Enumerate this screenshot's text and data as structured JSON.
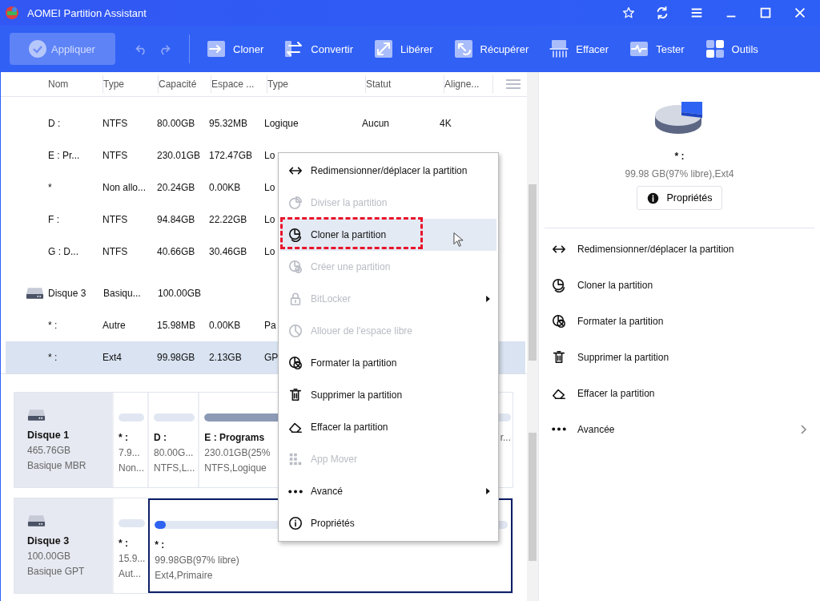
{
  "window": {
    "title": "AOMEI Partition Assistant"
  },
  "toolbar": {
    "apply": {
      "label": "Appliquer",
      "disabled": true
    },
    "tools": [
      {
        "kind": "clone",
        "label": "Cloner"
      },
      {
        "kind": "convert",
        "label": "Convertir"
      },
      {
        "kind": "free",
        "label": "Libérer"
      },
      {
        "kind": "recover",
        "label": "Récupérer"
      },
      {
        "kind": "wipe",
        "label": "Effacer"
      },
      {
        "kind": "test",
        "label": "Tester"
      },
      {
        "kind": "tools",
        "label": "Outils"
      }
    ]
  },
  "table": {
    "columns": [
      "Nom",
      "Type",
      "Capacité",
      "Espace ...",
      "Type",
      "Statut",
      "Aligne..."
    ],
    "rows": [
      {
        "kind": "partition",
        "selected": false,
        "cells": [
          "D :",
          "NTFS",
          "80.00GB",
          "95.32MB",
          "Logique",
          "Aucun",
          "4K"
        ]
      },
      {
        "kind": "partition",
        "selected": false,
        "cells": [
          "E : Pr...",
          "NTFS",
          "230.01GB",
          "172.47GB",
          "Lo"
        ]
      },
      {
        "kind": "partition",
        "selected": false,
        "cells": [
          "*",
          "Non allo...",
          "20.24GB",
          "0.00KB",
          "Lo"
        ]
      },
      {
        "kind": "partition",
        "selected": false,
        "cells": [
          "F :",
          "NTFS",
          "94.84GB",
          "22.22GB",
          "Lo"
        ]
      },
      {
        "kind": "partition",
        "selected": false,
        "cells": [
          "G : D...",
          "NTFS",
          "40.66GB",
          "30.46GB",
          "Lo"
        ]
      },
      {
        "kind": "disk",
        "selected": false,
        "cells": [
          "Disque 3",
          "Basiqu...",
          "100.00GB"
        ]
      },
      {
        "kind": "partition",
        "selected": false,
        "cells": [
          "* :",
          "Autre",
          "15.98MB",
          "0.00KB",
          "Pa"
        ]
      },
      {
        "kind": "partition",
        "selected": true,
        "cells": [
          "* :",
          "Ext4",
          "99.98GB",
          "2.13GB",
          "GP"
        ]
      }
    ]
  },
  "context_menu": {
    "items": [
      {
        "kind": "resize",
        "label": "Redimensionner/déplacer la partition",
        "disabled": false,
        "selected": false,
        "submenu": false,
        "annotated": false
      },
      {
        "kind": "split",
        "label": "Diviser la partition",
        "disabled": true,
        "selected": false,
        "submenu": false,
        "annotated": false
      },
      {
        "kind": "clone",
        "label": "Cloner la partition",
        "disabled": false,
        "selected": true,
        "submenu": false,
        "annotated": true
      },
      {
        "kind": "create",
        "label": "Créer une partition",
        "disabled": true,
        "selected": false,
        "submenu": false,
        "annotated": false
      },
      {
        "kind": "lock",
        "label": "BitLocker",
        "disabled": true,
        "selected": false,
        "submenu": true,
        "annotated": false
      },
      {
        "kind": "allocate",
        "label": "Allouer de l'espace libre",
        "disabled": true,
        "selected": false,
        "submenu": false,
        "annotated": false
      },
      {
        "kind": "format",
        "label": "Formater la partition",
        "disabled": false,
        "selected": false,
        "submenu": false,
        "annotated": false
      },
      {
        "kind": "delete",
        "label": "Supprimer la partition",
        "disabled": false,
        "selected": false,
        "submenu": false,
        "annotated": false
      },
      {
        "kind": "wipe",
        "label": "Effacer la partition",
        "disabled": false,
        "selected": false,
        "submenu": false,
        "annotated": false
      },
      {
        "kind": "apps",
        "label": "App Mover",
        "disabled": true,
        "selected": false,
        "submenu": false,
        "annotated": false
      },
      {
        "kind": "more",
        "label": "Avancé",
        "disabled": false,
        "selected": false,
        "submenu": true,
        "annotated": false
      },
      {
        "kind": "info",
        "label": "Propriétés",
        "disabled": false,
        "selected": false,
        "submenu": false,
        "annotated": false
      }
    ]
  },
  "disk_map": {
    "disks": [
      {
        "name": "Disque 1",
        "size": "465.76GB",
        "type": "Basique MBR",
        "partitions": [
          {
            "name": "* :",
            "size": "7.9...",
            "info": "Non...",
            "level": 0,
            "selected": false
          },
          {
            "name": "D :",
            "size": "80.00G...",
            "info": "NTFS,L...",
            "level": 0,
            "selected": false
          },
          {
            "name": "E : Programs",
            "size": "230.01GB(25%",
            "info": "NTFS,Logique",
            "level": 0.75,
            "selected": false
          },
          {
            "size": "r...",
            "level": 0,
            "selected": false
          }
        ]
      },
      {
        "name": "Disque 3",
        "size": "100.00GB",
        "type": "Basique GPT",
        "partitions": [
          {
            "name": "* :",
            "size": "15.9...",
            "info": "Aut...",
            "level": 0,
            "selected": false
          },
          {
            "name": "* :",
            "size": "99.98GB(97% libre)",
            "info": "Ext4,Primaire",
            "level": 0.03,
            "selected": true
          }
        ]
      }
    ]
  },
  "details": {
    "name": "* :",
    "summary": "99.98 GB(97% libre),Ext4",
    "button": "Propriétés",
    "actions": [
      {
        "kind": "resize",
        "label": "Redimensionner/déplacer la partition",
        "submenu": false
      },
      {
        "kind": "clone",
        "label": "Cloner la partition",
        "submenu": false
      },
      {
        "kind": "format",
        "label": "Formater la partition",
        "submenu": false
      },
      {
        "kind": "delete",
        "label": "Supprimer la partition",
        "submenu": false
      },
      {
        "kind": "wipe",
        "label": "Effacer la partition",
        "submenu": false
      },
      {
        "kind": "more",
        "label": "Avancée",
        "submenu": true
      }
    ]
  }
}
